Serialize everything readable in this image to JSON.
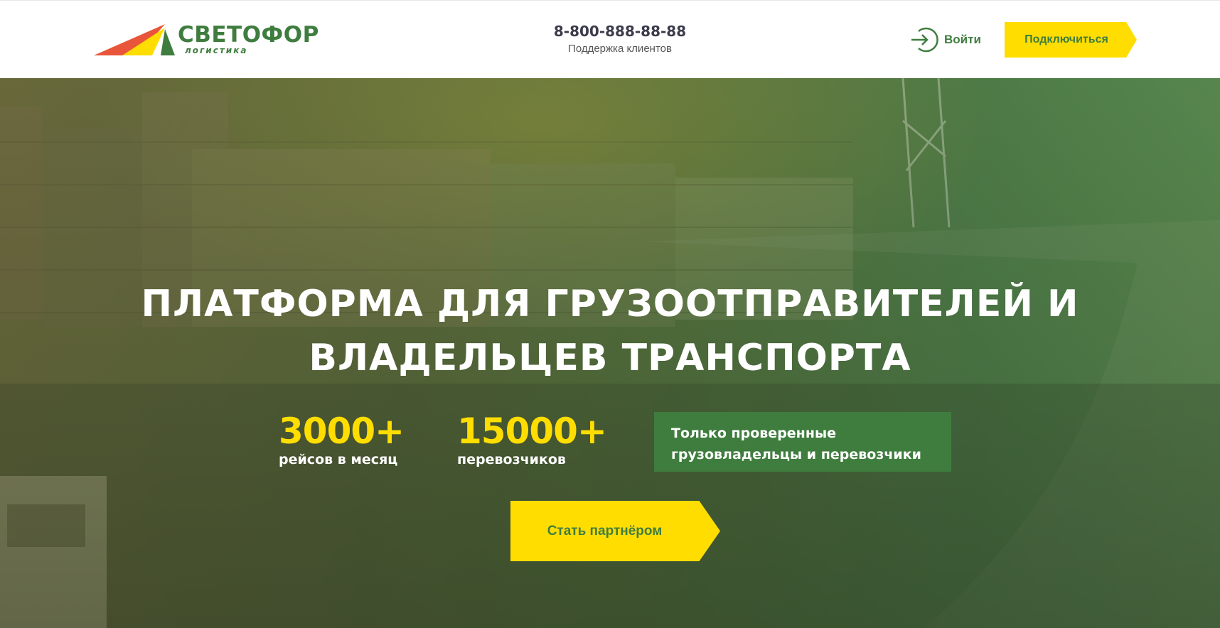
{
  "header": {
    "logo": {
      "name": "СВЕТОФОР",
      "sub": "логистика"
    },
    "phone": "8-800-888-88-88",
    "support_label": "Поддержка клиентов",
    "login_label": "Войти",
    "connect_label": "Подключиться"
  },
  "hero": {
    "title_line1": "ПЛАТФОРМА ДЛЯ ГРУЗООТПРАВИТЕЛЕЙ И",
    "title_line2": "ВЛАДЕЛЬЦЕВ ТРАНСПОРТА",
    "stats": [
      {
        "value": "3000+",
        "label": "рейсов в месяц"
      },
      {
        "value": "15000+",
        "label": "перевозчиков"
      }
    ],
    "verified_line1": "Только проверенные",
    "verified_line2": "грузовладельцы и перевозчики",
    "cta_label": "Стать партнёром"
  },
  "colors": {
    "brand_green": "#3f7d3f",
    "accent_yellow": "#ffdd00",
    "logo_red": "#e8553a"
  },
  "icons": [
    "logo-mark-icon",
    "login-arrow-icon"
  ]
}
